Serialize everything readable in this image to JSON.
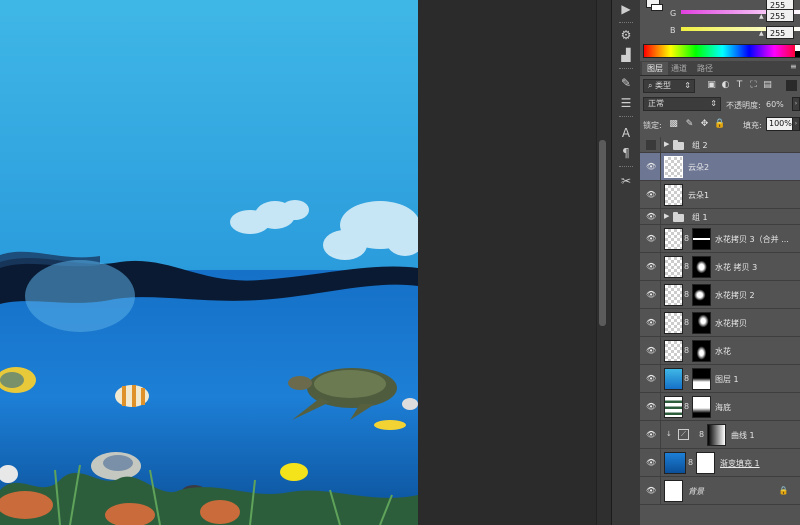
{
  "color_panel": {
    "rows": [
      {
        "label": "",
        "value": "255"
      },
      {
        "label": "G",
        "value": "255"
      },
      {
        "label": "B",
        "value": "255"
      }
    ],
    "colors": {
      "g_slider": "#e040e0",
      "b_slider": "#f0f040"
    }
  },
  "tabs": [
    "图层",
    "通道",
    "路径"
  ],
  "filter": {
    "kind_label": "类型"
  },
  "blend": {
    "mode": "正常",
    "opacity_label": "不透明度:",
    "opacity_value": "60%"
  },
  "lock": {
    "label": "锁定:",
    "fill_label": "填充:",
    "fill_value": "100%"
  },
  "layers": [
    {
      "name": "组 2",
      "type": "group",
      "visible": false
    },
    {
      "name": "云朵2",
      "type": "layer",
      "visible": true,
      "selected": true
    },
    {
      "name": "云朵1",
      "type": "layer",
      "visible": true
    },
    {
      "name": "组 1",
      "type": "group",
      "visible": true
    },
    {
      "name": "水花拷贝 3（合并 ...",
      "type": "masked",
      "visible": true
    },
    {
      "name": "水花 拷贝 3",
      "type": "masked",
      "visible": true
    },
    {
      "name": "水花拷贝 2",
      "type": "masked",
      "visible": true
    },
    {
      "name": "水花拷贝",
      "type": "masked",
      "visible": true
    },
    {
      "name": "水花",
      "type": "masked",
      "visible": true
    },
    {
      "name": "图层 1",
      "type": "masked",
      "visible": true
    },
    {
      "name": "海底",
      "type": "masked",
      "visible": true
    },
    {
      "name": "曲线 1",
      "type": "adjustment",
      "visible": true
    },
    {
      "name": "渐变填充 1",
      "type": "fill",
      "visible": true
    },
    {
      "name": "背景",
      "type": "background",
      "visible": true
    }
  ]
}
